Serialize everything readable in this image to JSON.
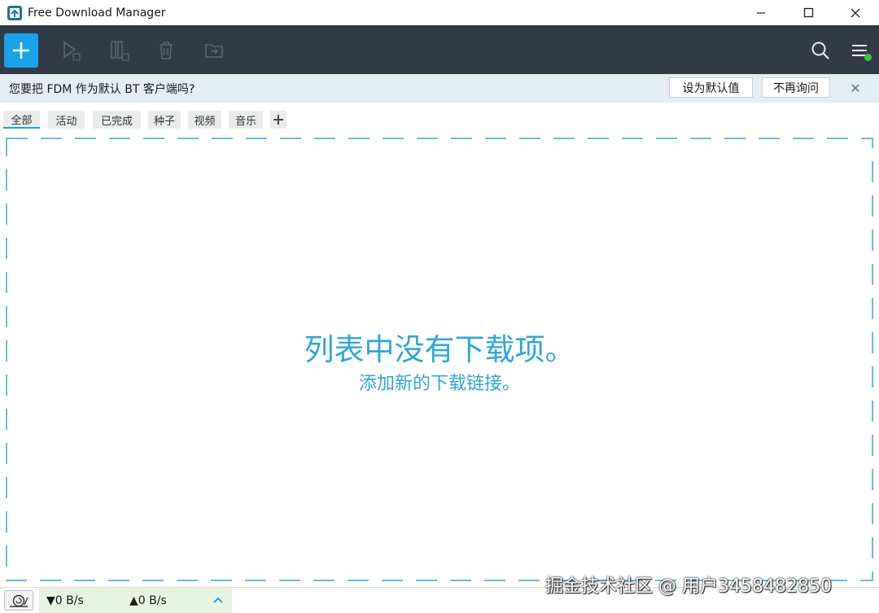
{
  "window": {
    "title": "Free Download Manager"
  },
  "toolbar": {
    "buttons": [
      {
        "name": "add",
        "icon": "plus-icon",
        "enabled": true
      },
      {
        "name": "resume",
        "icon": "play-queue-icon",
        "enabled": false
      },
      {
        "name": "pause",
        "icon": "pause-queue-icon",
        "enabled": false
      },
      {
        "name": "delete",
        "icon": "trash-icon",
        "enabled": false
      },
      {
        "name": "open-folder",
        "icon": "folder-icon",
        "enabled": false
      },
      {
        "name": "search",
        "icon": "search-icon",
        "enabled": true
      },
      {
        "name": "menu",
        "icon": "hamburger-menu-icon",
        "enabled": true
      }
    ]
  },
  "notification": {
    "text": "您要把 FDM 作为默认 BT 客户端吗?",
    "set_default_label": "设为默认值",
    "dont_ask_label": "不再询问",
    "close_glyph": "✕"
  },
  "tabs": {
    "items": [
      {
        "label": "全部",
        "active": true
      },
      {
        "label": "活动",
        "active": false
      },
      {
        "label": "已完成",
        "active": false
      },
      {
        "label": "种子",
        "active": false
      },
      {
        "label": "视频",
        "active": false
      },
      {
        "label": "音乐",
        "active": false
      }
    ]
  },
  "empty_state": {
    "message": "列表中没有下载项。",
    "hint": "添加新的下载链接。"
  },
  "status": {
    "download_speed": "▼0 B/s",
    "upload_speed": "▲0 B/s"
  },
  "watermark": "掘金技术社区 @ 用户3458482850",
  "colors": {
    "accent": "#1aa3e8",
    "toolbar_bg": "#323a48",
    "notify_bg": "#e3edf2",
    "status_green_bg": "#e7f4e2",
    "online_dot": "#3cc23c"
  }
}
